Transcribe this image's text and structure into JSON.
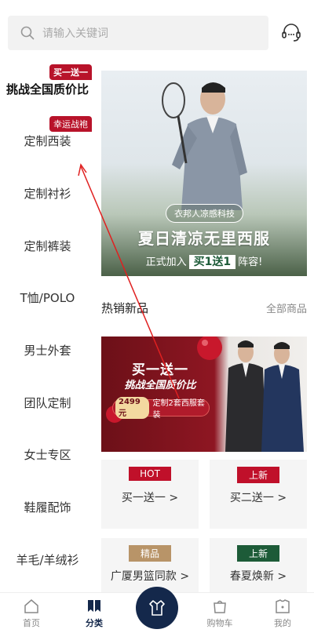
{
  "search": {
    "placeholder": "请输入关键词"
  },
  "sidebar": {
    "items": [
      {
        "label": "挑战全国质价比",
        "badge": "买一送一"
      },
      {
        "label": "定制西装",
        "badge": "幸运战袍"
      },
      {
        "label": "定制衬衫"
      },
      {
        "label": "定制裤装"
      },
      {
        "label": "T恤/POLO"
      },
      {
        "label": "男士外套"
      },
      {
        "label": "团队定制"
      },
      {
        "label": "女士专区"
      },
      {
        "label": "鞋履配饰"
      },
      {
        "label": "羊毛/羊绒衫"
      }
    ]
  },
  "banner": {
    "tag": "衣邦人凉感科技",
    "headline": "夏日清凉无里西服",
    "sub_before": "正式加入",
    "sub_highlight": "买1送1",
    "sub_after": "阵容!"
  },
  "section": {
    "title": "热销新品",
    "more": "全部商品"
  },
  "promo": {
    "line1": "买一送一",
    "line2": "挑战全国质价比",
    "price": "2499",
    "price_suffix": "元",
    "pill_text": "定制2套西服套装"
  },
  "cards": [
    {
      "badge": "HOT",
      "label": "买一送一 >",
      "badge_color": "#c0102a"
    },
    {
      "badge": "上新",
      "label": "买二送一 >",
      "badge_color": "#c0102a"
    },
    {
      "badge": "精品",
      "label": "广厦男篮同款 >",
      "badge_color": "#b89468"
    },
    {
      "badge": "上新",
      "label": "春夏焕新 >",
      "badge_color": "#1d5b38"
    }
  ],
  "bottom_nav": {
    "home": "首页",
    "category": "分类",
    "cart": "购物车",
    "mine": "我的"
  },
  "colors": {
    "accent": "#14284b",
    "badge_red": "#b8132a"
  },
  "icons": [
    "search-icon",
    "customer-service-icon",
    "home-icon",
    "category-icon",
    "suit-icon",
    "cart-icon",
    "profile-icon"
  ]
}
